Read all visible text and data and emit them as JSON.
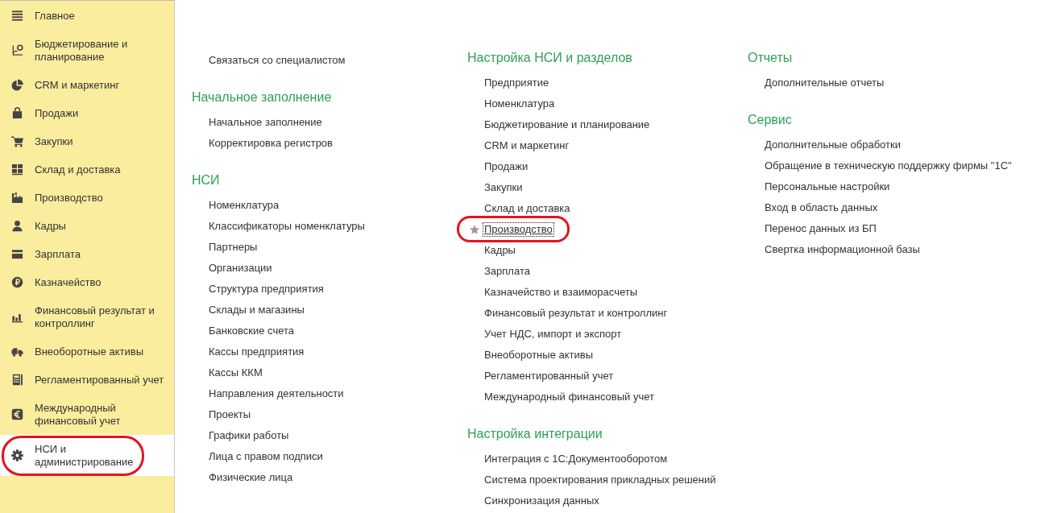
{
  "sidebar": {
    "items": [
      {
        "label": "Главное",
        "selected": false,
        "circled": false
      },
      {
        "label": "Бюджетирование и планирование",
        "selected": false,
        "circled": false
      },
      {
        "label": "CRM и маркетинг",
        "selected": false,
        "circled": false
      },
      {
        "label": "Продажи",
        "selected": false,
        "circled": false
      },
      {
        "label": "Закупки",
        "selected": false,
        "circled": false
      },
      {
        "label": "Склад и доставка",
        "selected": false,
        "circled": false
      },
      {
        "label": "Производство",
        "selected": false,
        "circled": false
      },
      {
        "label": "Кадры",
        "selected": false,
        "circled": false
      },
      {
        "label": "Зарплата",
        "selected": false,
        "circled": false
      },
      {
        "label": "Казначейство",
        "selected": false,
        "circled": false
      },
      {
        "label": "Финансовый результат и контроллинг",
        "selected": false,
        "circled": false
      },
      {
        "label": "Внеоборотные активы",
        "selected": false,
        "circled": false
      },
      {
        "label": "Регламентированный учет",
        "selected": false,
        "circled": false
      },
      {
        "label": "Международный финансовый учет",
        "selected": false,
        "circled": false
      },
      {
        "label": "НСИ и администрирование",
        "selected": true,
        "circled": true
      }
    ]
  },
  "columns": [
    {
      "sections": [
        {
          "links": [
            {
              "label": "Связаться со специалистом",
              "focused": false,
              "circled": false
            }
          ]
        },
        {
          "heading": "Начальное заполнение",
          "links": [
            {
              "label": "Начальное заполнение",
              "focused": false,
              "circled": false
            },
            {
              "label": "Корректировка регистров",
              "focused": false,
              "circled": false
            }
          ]
        },
        {
          "heading": "НСИ",
          "links": [
            {
              "label": "Номенклатура",
              "focused": false,
              "circled": false
            },
            {
              "label": "Классификаторы номенклатуры",
              "focused": false,
              "circled": false
            },
            {
              "label": "Партнеры",
              "focused": false,
              "circled": false
            },
            {
              "label": "Организации",
              "focused": false,
              "circled": false
            },
            {
              "label": "Структура предприятия",
              "focused": false,
              "circled": false
            },
            {
              "label": "Склады и магазины",
              "focused": false,
              "circled": false
            },
            {
              "label": "Банковские счета",
              "focused": false,
              "circled": false
            },
            {
              "label": "Кассы предприятия",
              "focused": false,
              "circled": false
            },
            {
              "label": "Кассы ККМ",
              "focused": false,
              "circled": false
            },
            {
              "label": "Направления деятельности",
              "focused": false,
              "circled": false
            },
            {
              "label": "Проекты",
              "focused": false,
              "circled": false
            },
            {
              "label": "Графики работы",
              "focused": false,
              "circled": false
            },
            {
              "label": "Лица с правом подписи",
              "focused": false,
              "circled": false
            },
            {
              "label": "Физические лица",
              "focused": false,
              "circled": false
            }
          ]
        }
      ]
    },
    {
      "sections": [
        {
          "heading": "Настройка НСИ и разделов",
          "links": [
            {
              "label": "Предприятие",
              "focused": false,
              "circled": false
            },
            {
              "label": "Номенклатура",
              "focused": false,
              "circled": false
            },
            {
              "label": "Бюджетирование и планирование",
              "focused": false,
              "circled": false
            },
            {
              "label": "CRM и маркетинг",
              "focused": false,
              "circled": false
            },
            {
              "label": "Продажи",
              "focused": false,
              "circled": false
            },
            {
              "label": "Закупки",
              "focused": false,
              "circled": false
            },
            {
              "label": "Склад и доставка",
              "focused": false,
              "circled": false
            },
            {
              "label": "Производство",
              "focused": true,
              "circled": true
            },
            {
              "label": "Кадры",
              "focused": false,
              "circled": false
            },
            {
              "label": "Зарплата",
              "focused": false,
              "circled": false
            },
            {
              "label": "Казначейство и взаиморасчеты",
              "focused": false,
              "circled": false
            },
            {
              "label": "Финансовый результат и контроллинг",
              "focused": false,
              "circled": false
            },
            {
              "label": "Учет НДС, импорт и экспорт",
              "focused": false,
              "circled": false
            },
            {
              "label": "Внеоборотные активы",
              "focused": false,
              "circled": false
            },
            {
              "label": "Регламентированный учет",
              "focused": false,
              "circled": false
            },
            {
              "label": "Международный финансовый учет",
              "focused": false,
              "circled": false
            }
          ]
        },
        {
          "heading": "Настройка интеграции",
          "links": [
            {
              "label": "Интеграция с 1С:Документооборотом",
              "focused": false,
              "circled": false
            },
            {
              "label": "Система проектирования прикладных решений",
              "focused": false,
              "circled": false
            },
            {
              "label": "Синхронизация данных",
              "focused": false,
              "circled": false
            }
          ]
        }
      ]
    },
    {
      "sections": [
        {
          "heading": "Отчеты",
          "links": [
            {
              "label": "Дополнительные отчеты",
              "focused": false,
              "circled": false
            }
          ]
        },
        {
          "heading": "Сервис",
          "links": [
            {
              "label": "Дополнительные обработки",
              "focused": false,
              "circled": false
            },
            {
              "label": "Обращение в техническую поддержку фирмы \"1С\"",
              "focused": false,
              "circled": false
            },
            {
              "label": "Персональные настройки",
              "focused": false,
              "circled": false
            },
            {
              "label": "Вход в область данных",
              "focused": false,
              "circled": false
            },
            {
              "label": "Перенос данных из БП",
              "focused": false,
              "circled": false
            },
            {
              "label": "Свертка информационной базы",
              "focused": false,
              "circled": false
            }
          ]
        }
      ]
    }
  ]
}
